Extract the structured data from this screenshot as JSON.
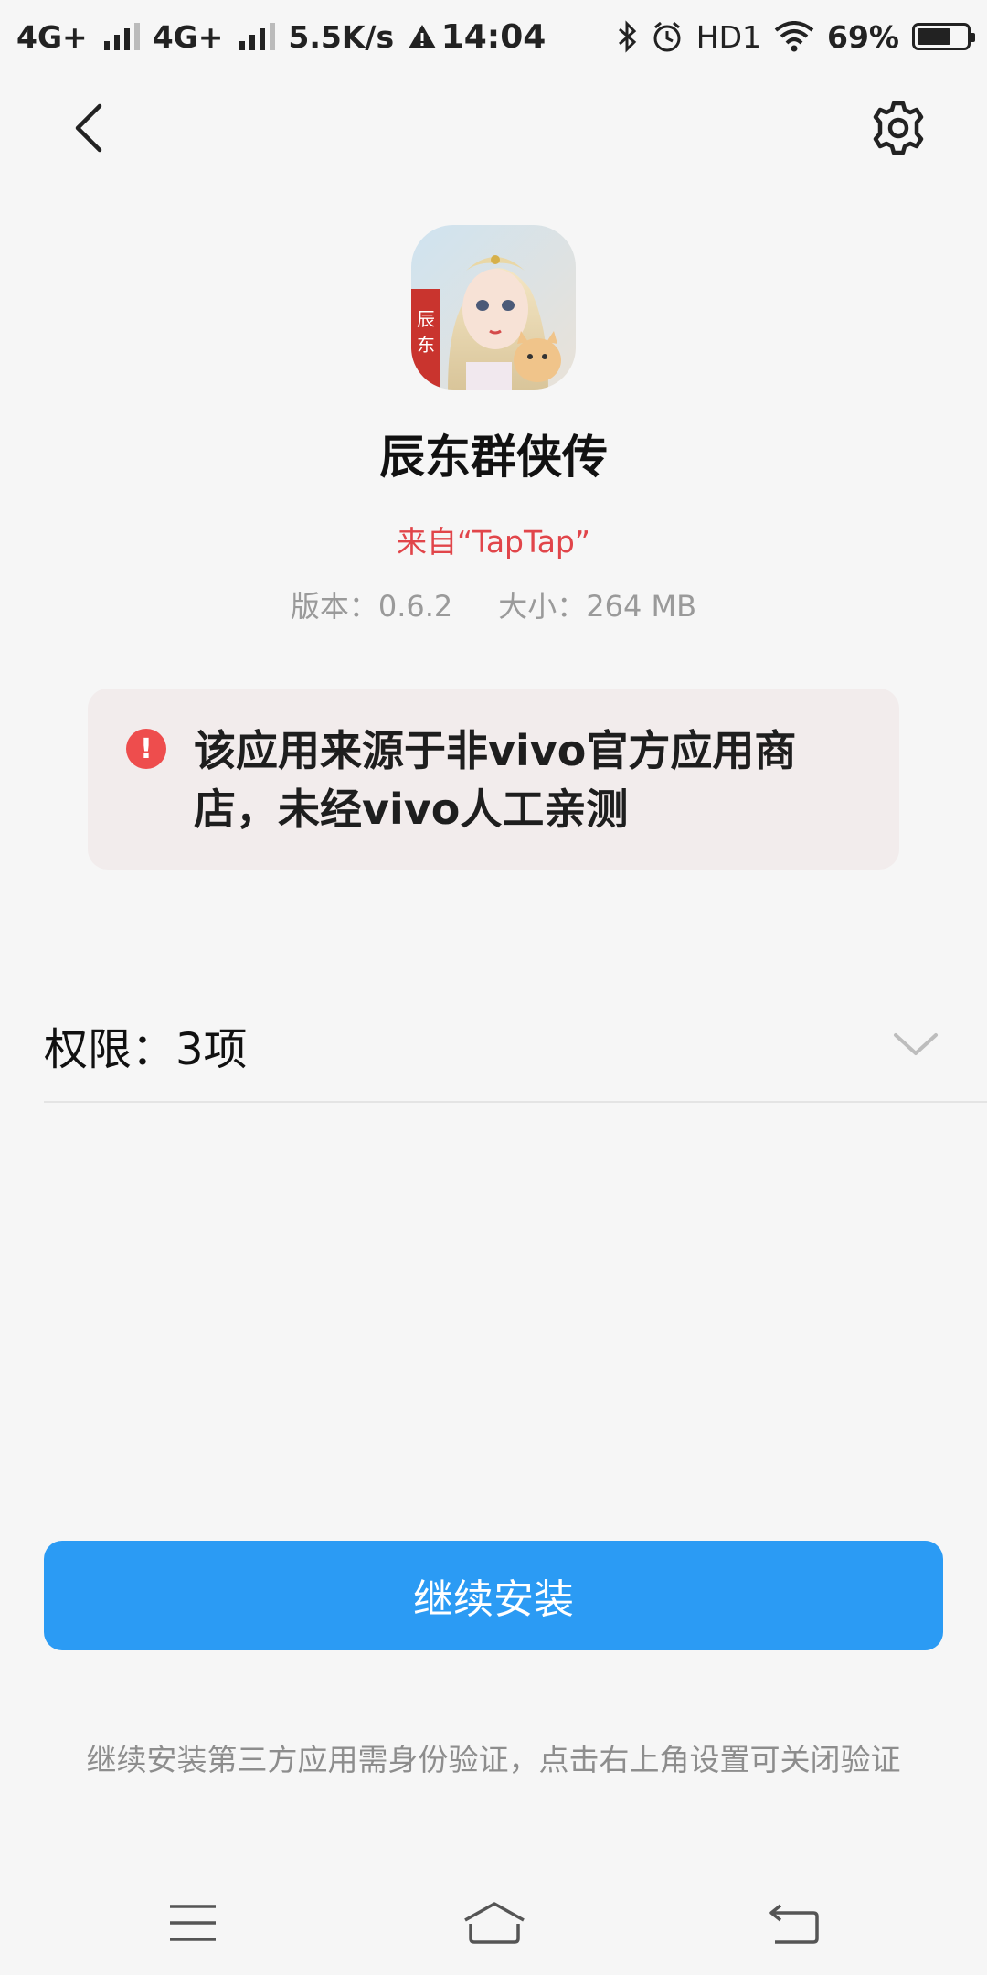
{
  "status_bar": {
    "signal1": "4G+",
    "signal2": "4G+",
    "net_speed": "5.5K/s",
    "time": "14:04",
    "hd": "HD1",
    "battery": "69%",
    "battery_level": 0.69
  },
  "app": {
    "name": "辰东群侠传",
    "source": "来自“TapTap”",
    "version": "版本：0.6.2",
    "size": "大小：264 MB",
    "icon_text": "辰东"
  },
  "warning": {
    "text": "该应用来源于非vivo官方应用商店，未经vivo人工亲测"
  },
  "permissions": {
    "label": "权限：3项"
  },
  "install_button": {
    "label": "继续安装"
  },
  "footnote": "继续安装第三方应用需身份验证，点击右上角设置可关闭验证",
  "colors": {
    "accent": "#2b9bf4",
    "warning_red": "#e1454a",
    "background": "#f6f6f6"
  }
}
